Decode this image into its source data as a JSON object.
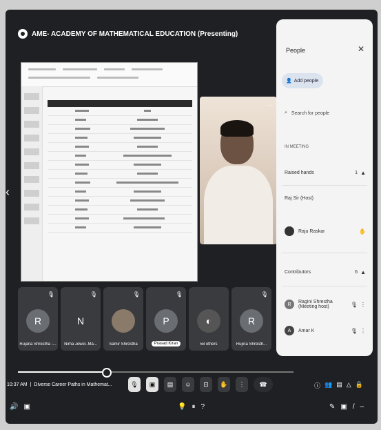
{
  "header": {
    "meeting_title": "AME- ACADEMY OF MATHEMATICAL EDUCATION (Presenting)"
  },
  "people_panel": {
    "title": "People",
    "add_people": "Add people",
    "search_placeholder": "Search for people",
    "section_in_meeting": "IN MEETING",
    "raised_hands_label": "Raised hands",
    "raised_hands_count": "1",
    "contributors_label": "Contributors",
    "contributors_count": "6",
    "hosted_label": "Raj Sir (Host)",
    "participants": [
      {
        "initial": "R",
        "name": "Ragini Shrestha",
        "sub": "(Meeting host)"
      },
      {
        "initial": "A",
        "name": "Amar K"
      }
    ]
  },
  "tiles": [
    {
      "initial": "R",
      "name": "Rujana Shrestha -...",
      "color": "#6a6d72"
    },
    {
      "initial": "N",
      "name": "Nima Jewel..Ma...",
      "color": "#3a3b3e"
    },
    {
      "initial": "",
      "name": "Samir Shrestha",
      "color": "#8a7a6a"
    },
    {
      "initial": "P",
      "name": "Prasad Kiran",
      "color": "#6a6d72"
    },
    {
      "initial": "",
      "name": "58 others",
      "color": "#3a3b3e"
    },
    {
      "initial": "R",
      "name": "Rujina Shresth...",
      "color": "#6a6d72"
    }
  ],
  "status": {
    "time": "10:37 AM",
    "meeting_name": "Diverse Career Paths in Mathemat..."
  },
  "progress": {
    "fraction": 0.32
  },
  "colors": {
    "accent": "#dbe3ef",
    "panel": "#f4f4f4",
    "dark": "#1f2023"
  }
}
